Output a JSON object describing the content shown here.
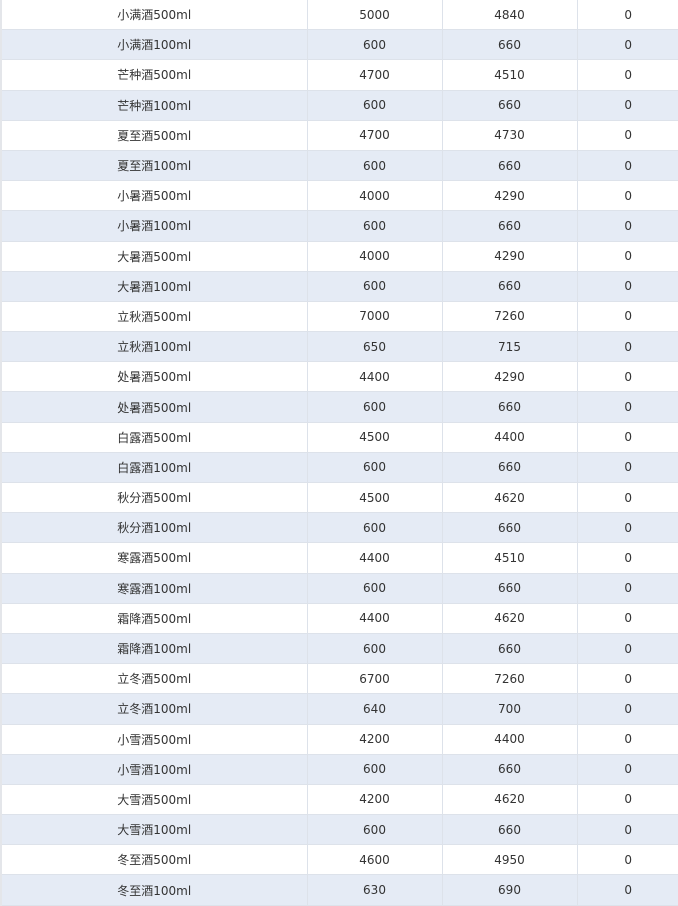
{
  "table": {
    "rows": [
      [
        "小满酒500ml",
        "5000",
        "4840",
        "0"
      ],
      [
        "小满酒100ml",
        "600",
        "660",
        "0"
      ],
      [
        "芒种酒500ml",
        "4700",
        "4510",
        "0"
      ],
      [
        "芒种酒100ml",
        "600",
        "660",
        "0"
      ],
      [
        "夏至酒500ml",
        "4700",
        "4730",
        "0"
      ],
      [
        "夏至酒100ml",
        "600",
        "660",
        "0"
      ],
      [
        "小暑酒500ml",
        "4000",
        "4290",
        "0"
      ],
      [
        "小暑酒100ml",
        "600",
        "660",
        "0"
      ],
      [
        "大暑酒500ml",
        "4000",
        "4290",
        "0"
      ],
      [
        "大暑酒100ml",
        "600",
        "660",
        "0"
      ],
      [
        "立秋酒500ml",
        "7000",
        "7260",
        "0"
      ],
      [
        "立秋酒100ml",
        "650",
        "715",
        "0"
      ],
      [
        "处暑酒500ml",
        "4400",
        "4290",
        "0"
      ],
      [
        "处暑酒500ml",
        "600",
        "660",
        "0"
      ],
      [
        "白露酒500ml",
        "4500",
        "4400",
        "0"
      ],
      [
        "白露酒100ml",
        "600",
        "660",
        "0"
      ],
      [
        "秋分酒500ml",
        "4500",
        "4620",
        "0"
      ],
      [
        "秋分酒100ml",
        "600",
        "660",
        "0"
      ],
      [
        "寒露酒500ml",
        "4400",
        "4510",
        "0"
      ],
      [
        "寒露酒100ml",
        "600",
        "660",
        "0"
      ],
      [
        "霜降酒500ml",
        "4400",
        "4620",
        "0"
      ],
      [
        "霜降酒100ml",
        "600",
        "660",
        "0"
      ],
      [
        "立冬酒500ml",
        "6700",
        "7260",
        "0"
      ],
      [
        "立冬酒100ml",
        "640",
        "700",
        "0"
      ],
      [
        "小雪酒500ml",
        "4200",
        "4400",
        "0"
      ],
      [
        "小雪酒100ml",
        "600",
        "660",
        "0"
      ],
      [
        "大雪酒500ml",
        "4200",
        "4620",
        "0"
      ],
      [
        "大雪酒100ml",
        "600",
        "660",
        "0"
      ],
      [
        "冬至酒500ml",
        "4600",
        "4950",
        "0"
      ],
      [
        "冬至酒100ml",
        "630",
        "690",
        "0"
      ]
    ]
  }
}
